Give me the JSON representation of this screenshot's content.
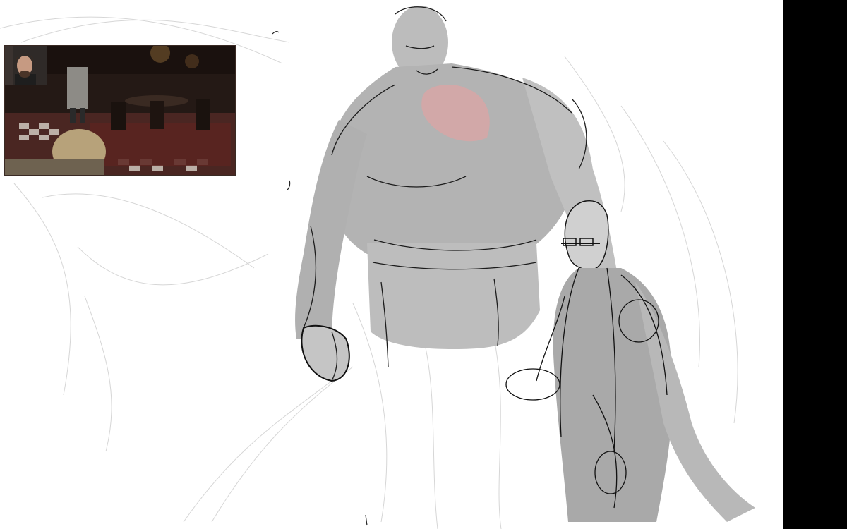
{
  "app": {
    "view": "drawing-canvas-with-reference"
  },
  "colors": {
    "canvas_background": "#ffffff",
    "right_bar": "#000000",
    "sketch_fill_gray": "#b5b5b5",
    "sketch_line": "#1a1a1a",
    "accent_red": "#c98a8a",
    "reference_room_dark": "#2a1e1a",
    "reference_carpet": "#4a2a24"
  },
  "icons": {
    "reference_panel": "reference-image-icon",
    "webcam": "webcam-icon"
  },
  "layers": [
    {
      "name": "sketch-figure-large",
      "type": "gray-silhouette-with-linework"
    },
    {
      "name": "sketch-figure-suited",
      "type": "gray-silhouette-with-linework"
    },
    {
      "name": "faint-construction-lines",
      "type": "light-gray-strokes"
    }
  ]
}
